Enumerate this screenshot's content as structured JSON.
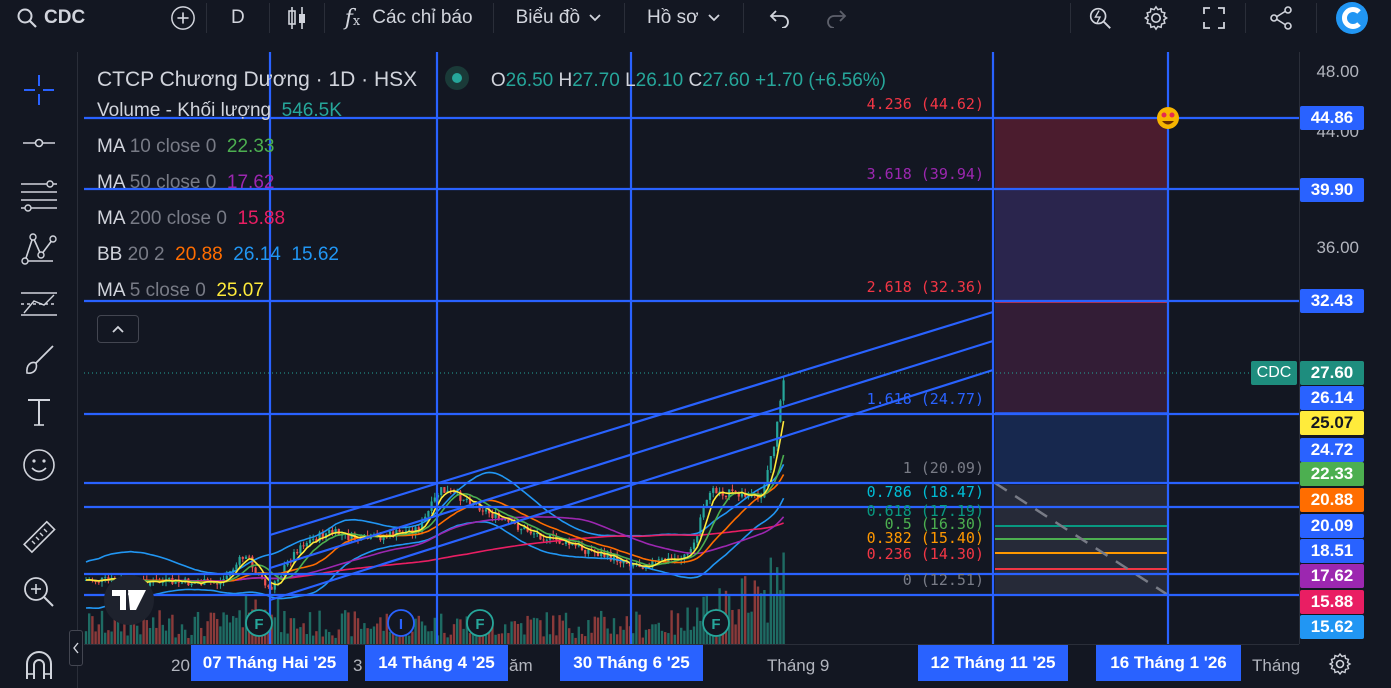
{
  "topbar": {
    "symbol": "CDC",
    "interval": "D",
    "indicators_label": "Các chỉ báo",
    "layout_label": "Biểu đồ",
    "profile_label": "Hồ sơ"
  },
  "legend": {
    "title": "CTCP Chương Dương · 1D · HSX",
    "ohlc": {
      "o_key": "O",
      "o": "26.50",
      "h_key": "H",
      "h": "27.70",
      "l_key": "L",
      "l": "26.10",
      "c_key": "C",
      "c": "27.60",
      "change": "+1.70 (+6.56%)"
    },
    "rows": [
      {
        "name": "Volume - Khối lượng",
        "params": "",
        "values": [
          "546.5K"
        ],
        "colors": [
          "#26a69a"
        ]
      },
      {
        "name": "MA",
        "params": "10 close 0",
        "values": [
          "22.33"
        ],
        "colors": [
          "#4caf50"
        ]
      },
      {
        "name": "MA",
        "params": "50 close 0",
        "values": [
          "17.62"
        ],
        "colors": [
          "#9c27b0"
        ]
      },
      {
        "name": "MA",
        "params": "200 close 0",
        "values": [
          "15.88"
        ],
        "colors": [
          "#e91e63"
        ]
      },
      {
        "name": "BB",
        "params": "20 2",
        "values": [
          "20.88",
          "26.14",
          "15.62"
        ],
        "colors": [
          "#ff6d00",
          "#2196f3",
          "#2196f3"
        ]
      },
      {
        "name": "MA",
        "params": "5 close 0",
        "values": [
          "25.07"
        ],
        "colors": [
          "#ffeb3b"
        ]
      }
    ]
  },
  "fib_levels": [
    {
      "label": "4.236 (44.62)",
      "color": "#f23645"
    },
    {
      "label": "3.618 (39.94)",
      "color": "#9c27b0"
    },
    {
      "label": "2.618 (32.36)",
      "color": "#f23645"
    },
    {
      "label": "1.618 (24.77)",
      "color": "#2962ff"
    },
    {
      "label": "1 (20.09)",
      "color": "#787b86"
    },
    {
      "label": "0.786 (18.47)",
      "color": "#00bcd4"
    },
    {
      "label": "0.618 (17.19)",
      "color": "#089981"
    },
    {
      "label": "0.5 (16.30)",
      "color": "#4caf50"
    },
    {
      "label": "0.382 (15.40)",
      "color": "#ff9800"
    },
    {
      "label": "0.236 (14.30)",
      "color": "#f23645"
    },
    {
      "label": "0 (12.51)",
      "color": "#787b86"
    }
  ],
  "price_axis": {
    "labels": [
      "48.00",
      "44.00",
      "36.00"
    ],
    "symbol_tag": "CDC",
    "tags": [
      {
        "text": "44.86",
        "bg": "#2962ff",
        "fg": "#ffffff"
      },
      {
        "text": "39.90",
        "bg": "#2962ff",
        "fg": "#ffffff"
      },
      {
        "text": "32.43",
        "bg": "#2962ff",
        "fg": "#ffffff"
      },
      {
        "text": "27.60",
        "bg": "#1e8d7e",
        "fg": "#ffffff"
      },
      {
        "text": "26.14",
        "bg": "#2962ff",
        "fg": "#ffffff"
      },
      {
        "text": "25.07",
        "bg": "#ffeb3b",
        "fg": "#131722"
      },
      {
        "text": "24.72",
        "bg": "#2962ff",
        "fg": "#ffffff"
      },
      {
        "text": "22.33",
        "bg": "#4caf50",
        "fg": "#ffffff"
      },
      {
        "text": "20.88",
        "bg": "#ff6d00",
        "fg": "#ffffff"
      },
      {
        "text": "20.09",
        "bg": "#2962ff",
        "fg": "#ffffff"
      },
      {
        "text": "18.51",
        "bg": "#2962ff",
        "fg": "#ffffff"
      },
      {
        "text": "17.62",
        "bg": "#9c27b0",
        "fg": "#ffffff"
      },
      {
        "text": "15.88",
        "bg": "#e91e63",
        "fg": "#ffffff"
      },
      {
        "text": "15.62",
        "bg": "#2196f3",
        "fg": "#ffffff"
      }
    ]
  },
  "time_axis": {
    "labels": [
      "20",
      "3",
      "ăm",
      "Tháng 9",
      "Tháng"
    ],
    "tags": [
      "07 Tháng Hai '25",
      "14 Tháng 4 '25",
      "30 Tháng 6 '25",
      "12 Tháng 11 '25",
      "16 Tháng 1 '26"
    ]
  },
  "markers": [
    "F",
    "I",
    "F",
    "F"
  ],
  "colors": {
    "accent": "#2962ff",
    "up": "#26a69a",
    "down": "#ef5350",
    "background": "#131722"
  }
}
